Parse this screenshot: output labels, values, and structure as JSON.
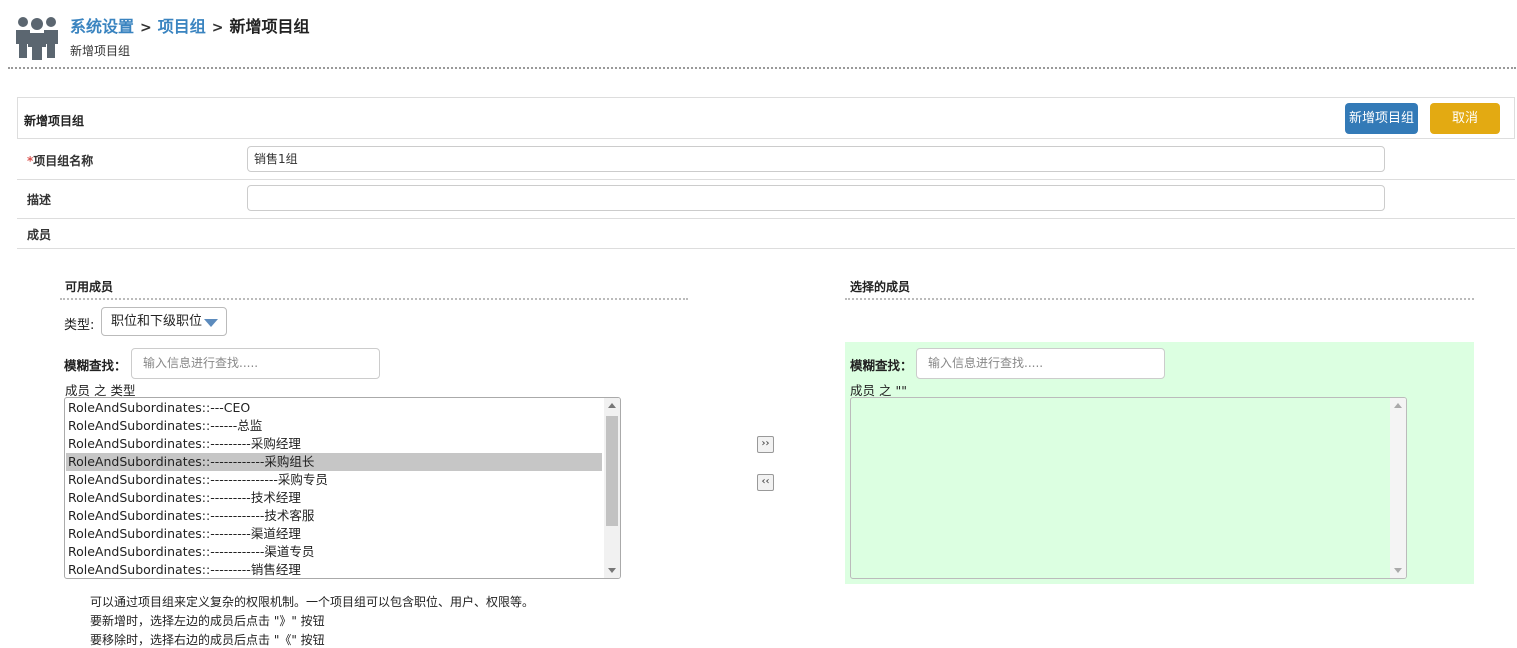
{
  "breadcrumb": {
    "items": [
      "系统设置",
      "项目组"
    ],
    "separator": ">",
    "current": "新增项目组"
  },
  "subtitle": "新增项目组",
  "form": {
    "panel_title": "新增项目组",
    "add_button": "新增项目组",
    "cancel_button": "取消",
    "name_label_required": "*",
    "name_label": "项目组名称",
    "name_value": "销售1组",
    "desc_label": "描述",
    "desc_value": "",
    "members_label": "成员"
  },
  "available": {
    "title": "可用成员",
    "type_label": "类型:",
    "type_selected": "职位和下级职位",
    "search_label": "模糊查找：",
    "search_placeholder": "输入信息进行查找.....",
    "list_caption": "成员 之 类型",
    "items": [
      "RoleAndSubordinates::---CEO",
      "RoleAndSubordinates::------总监",
      "RoleAndSubordinates::---------采购经理",
      "RoleAndSubordinates::------------采购组长",
      "RoleAndSubordinates::---------------采购专员",
      "RoleAndSubordinates::---------技术经理",
      "RoleAndSubordinates::------------技术客服",
      "RoleAndSubordinates::---------渠道经理",
      "RoleAndSubordinates::------------渠道专员",
      "RoleAndSubordinates::---------销售经理"
    ],
    "selected_index": 3
  },
  "move": {
    "add_symbol": "››",
    "remove_symbol": "‹‹"
  },
  "selected": {
    "title": "选择的成员",
    "search_label": "模糊查找：",
    "search_placeholder": "输入信息进行查找.....",
    "list_caption": "成员 之 \"\""
  },
  "notes": {
    "line1": "可以通过项目组来定义复杂的权限机制。一个项目组可以包含职位、用户、权限等。",
    "line2": "要新增时，选择左边的成员后点击 \"》\" 按钮",
    "line3": "要移除时，选择右边的成员后点击 \"《\" 按钮"
  },
  "colors": {
    "link": "#3a84c0",
    "primary_button": "#337ab7",
    "cancel_button": "#e3aa12",
    "selected_area": "#dcffe1",
    "list_selection": "#c6c6c6"
  },
  "icons": {
    "header": "group-people-icon",
    "dropdown": "caret-down-icon"
  }
}
